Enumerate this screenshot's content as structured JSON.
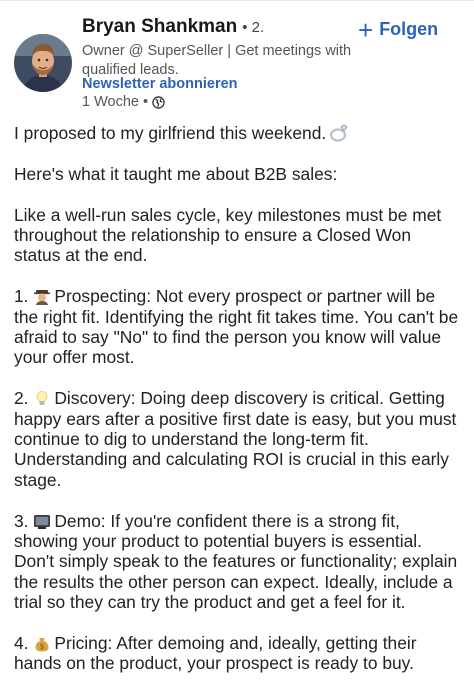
{
  "author": {
    "name": "Bryan Shankman",
    "degree": "• 2.",
    "headline": "Owner @ SuperSeller | Get meetings with qualified leads.",
    "newsletter_label": "Newsletter abonnieren",
    "time": "1 Woche",
    "visibility_icon": "globe-icon",
    "follow_label": "Folgen",
    "follow_icon": "plus-icon"
  },
  "colors": {
    "link_blue": "#2c63b8",
    "text": "#222222",
    "muted": "#555555"
  },
  "post": {
    "intro": "I proposed to my girlfriend this weekend.",
    "intro_emoji": "ring-emoji",
    "lesson": "Here's what it taught me about B2B sales:",
    "analogy": "Like a well-run sales cycle, key milestones must be met throughout the relationship to ensure a Closed Won status at the end.",
    "points": [
      {
        "number": "1.",
        "emoji": "detective-emoji",
        "text": "Prospecting: Not every prospect or partner will be the right fit. Identifying the right fit takes time. You can't be afraid to say \"No\" to find the person you know will value your offer most."
      },
      {
        "number": "2.",
        "emoji": "lightbulb-emoji",
        "text": "Discovery: Doing deep discovery is critical. Getting happy ears after a positive first date is easy, but you must continue to dig to understand the long-term fit. Understanding and calculating ROI is crucial in this early stage."
      },
      {
        "number": "3.",
        "emoji": "tv-emoji",
        "text": "Demo: If you're confident there is a strong fit, showing your product to potential buyers is essential. Don't simply speak to the features or functionality; explain the results the other person can expect. Ideally, include a trial so they can try the product and get a feel for it."
      },
      {
        "number": "4.",
        "emoji": "money-bag-emoji",
        "text": "Pricing: After demoing and, ideally, getting their hands on the product, your prospect is ready to buy."
      }
    ]
  }
}
